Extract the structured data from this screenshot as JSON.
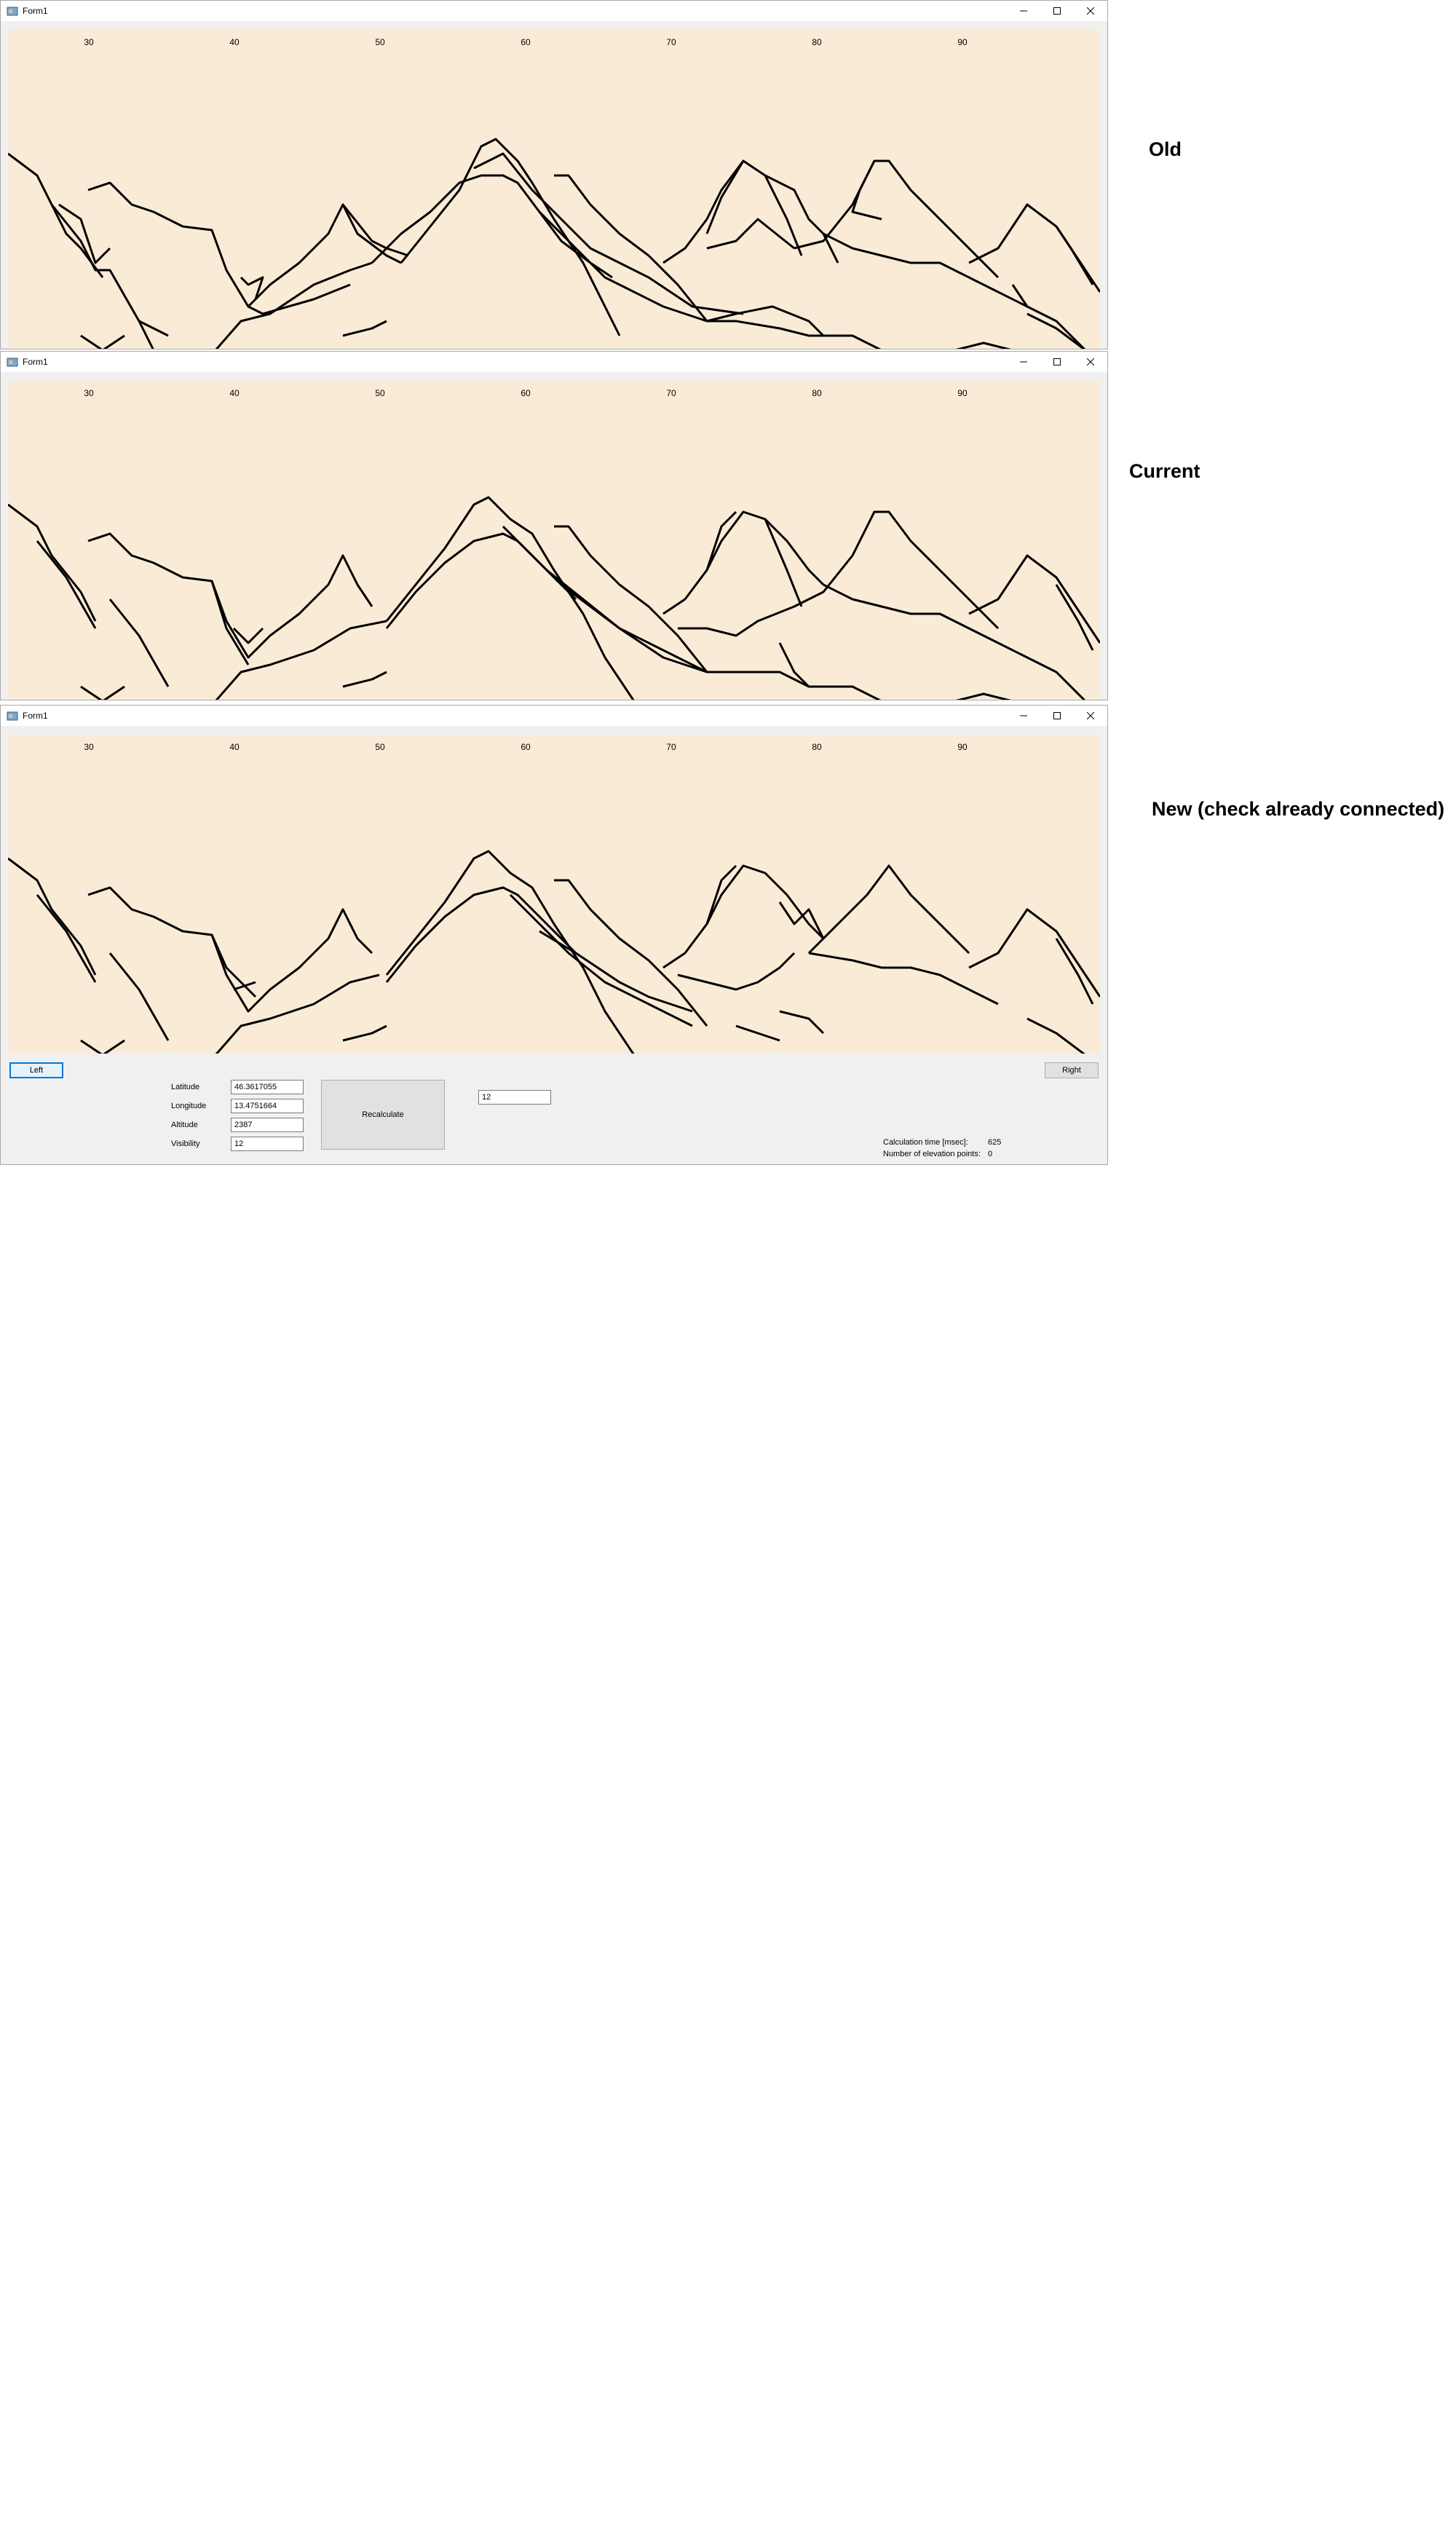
{
  "windows": [
    {
      "title": "Form1",
      "label": "Old"
    },
    {
      "title": "Form1",
      "label": "Current"
    },
    {
      "title": "Form1",
      "label": "New (check already connected)"
    }
  ],
  "axis_ticks": [
    "30",
    "40",
    "50",
    "60",
    "70",
    "80",
    "90"
  ],
  "colors": {
    "canvas_background": "#faebd7",
    "line": "#000000",
    "form_background": "#f0f0f0"
  },
  "icons": {
    "minimize": "minimize-icon",
    "maximize": "maximize-icon",
    "close": "close-icon",
    "app": "form-app-icon"
  },
  "controls": {
    "left_button": "Left",
    "right_button": "Right",
    "recalculate_button": "Recalculate",
    "latitude_label": "Latitude",
    "latitude_value": "46.3617055",
    "longitude_label": "Longitude",
    "longitude_value": "13.4751664",
    "altitude_label": "Altitude",
    "altitude_value": "2387",
    "visibility_label": "Visibility",
    "visibility_value": "12",
    "extra_value": "12",
    "calc_time_label": "Calculation time [msec]:",
    "calc_time_value": "625",
    "elevation_points_label": "Number of elevation points:",
    "elevation_points_value": "0"
  }
}
